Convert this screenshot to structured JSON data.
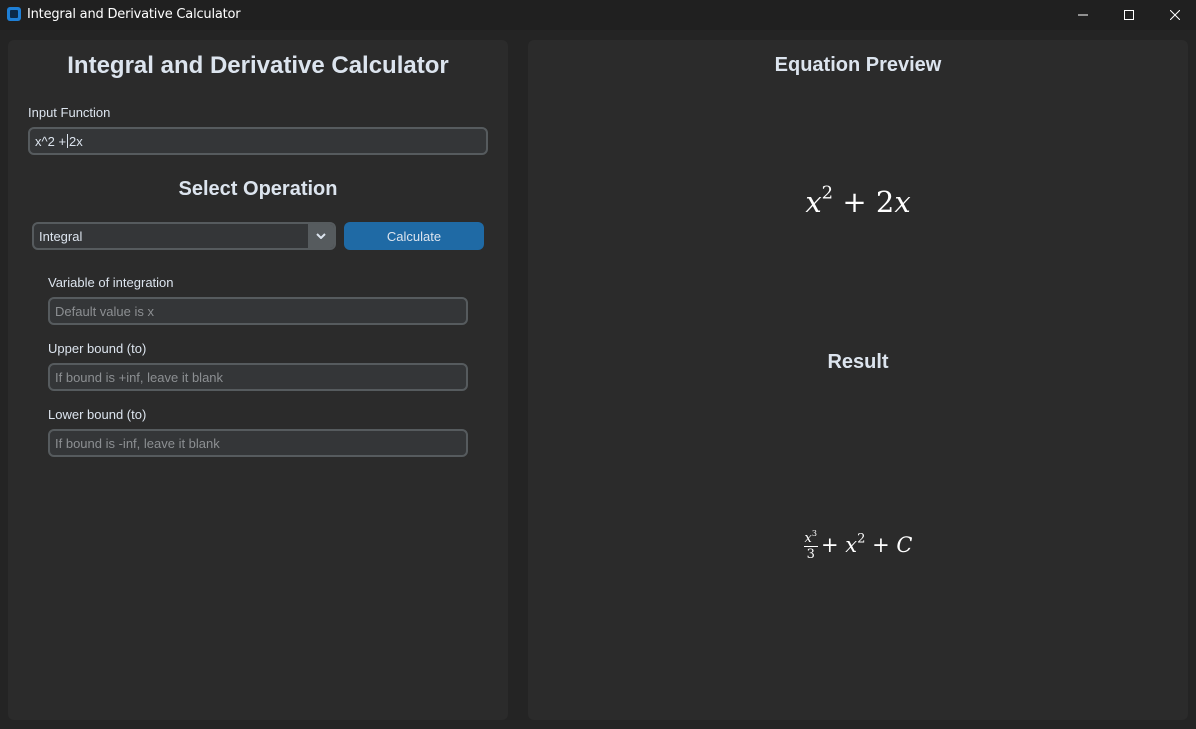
{
  "window": {
    "title": "Integral and Derivative Calculator",
    "controls": [
      "minimize",
      "maximize",
      "close"
    ]
  },
  "left": {
    "title": "Integral and Derivative Calculator",
    "input_label": "Input Function",
    "input_value_before_caret": "x^2 +",
    "input_value_after_caret": "2x",
    "select_title": "Select Operation",
    "operation_selected": "Integral",
    "calculate_label": "Calculate",
    "variable_label": "Variable of integration",
    "variable_placeholder": "Default value is x",
    "upper_label": "Upper bound (to)",
    "upper_placeholder": "If bound is +inf, leave it blank",
    "lower_label": "Lower bound (to)",
    "lower_placeholder": "If bound is -inf, leave it blank"
  },
  "right": {
    "preview_title": "Equation Preview",
    "preview_terms": {
      "x1": "x",
      "exp1": "2",
      "op1": "+",
      "term2": "2",
      "x2": "x"
    },
    "result_title": "Result",
    "result_terms": {
      "frac_num_x": "x",
      "frac_num_exp": "3",
      "frac_den": "3",
      "op1": "+",
      "x2": "x",
      "exp2": "2",
      "op2": "+",
      "const": "C"
    }
  },
  "colors": {
    "background": "#242424",
    "panel": "#2b2b2b",
    "accent": "#1f6aa5",
    "field": "#343638",
    "border": "#565b5e"
  }
}
